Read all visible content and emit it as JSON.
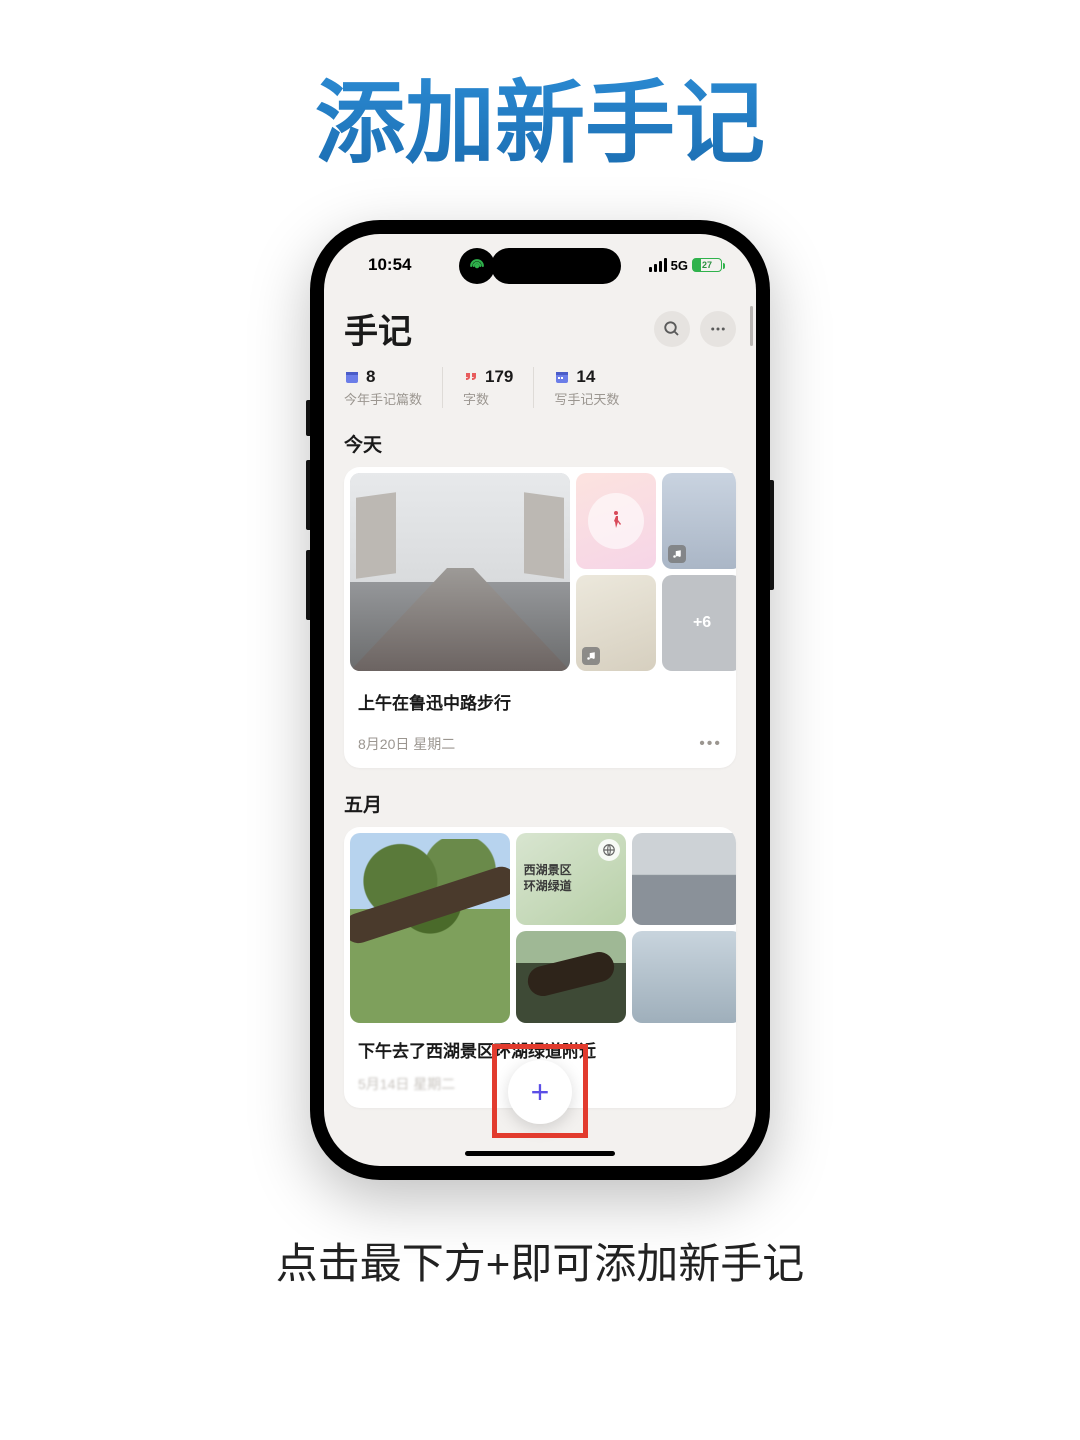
{
  "headline": "添加新手记",
  "status": {
    "time": "10:54",
    "network": "5G",
    "battery_pct": "27"
  },
  "header": {
    "title": "手记"
  },
  "stats": [
    {
      "value": "8",
      "label": "今年手记篇数",
      "icon": "journal",
      "color": "#6b7de8"
    },
    {
      "value": "179",
      "label": "字数",
      "icon": "quote",
      "color": "#e85c5c"
    },
    {
      "value": "14",
      "label": "写手记天数",
      "icon": "calendar",
      "color": "#6b7de8"
    }
  ],
  "sections": [
    {
      "label": "今天",
      "entry": {
        "title": "上午在鲁迅中路步行",
        "date": "8月20日 星期二",
        "extra_count": "+6"
      }
    },
    {
      "label": "五月",
      "entry": {
        "title": "下午去了西湖景区环湖绿道附近",
        "location": "西湖景区\n环湖绿道",
        "date": "5月14日 星期二"
      }
    }
  ],
  "caption": "点击最下方+即可添加新手记"
}
